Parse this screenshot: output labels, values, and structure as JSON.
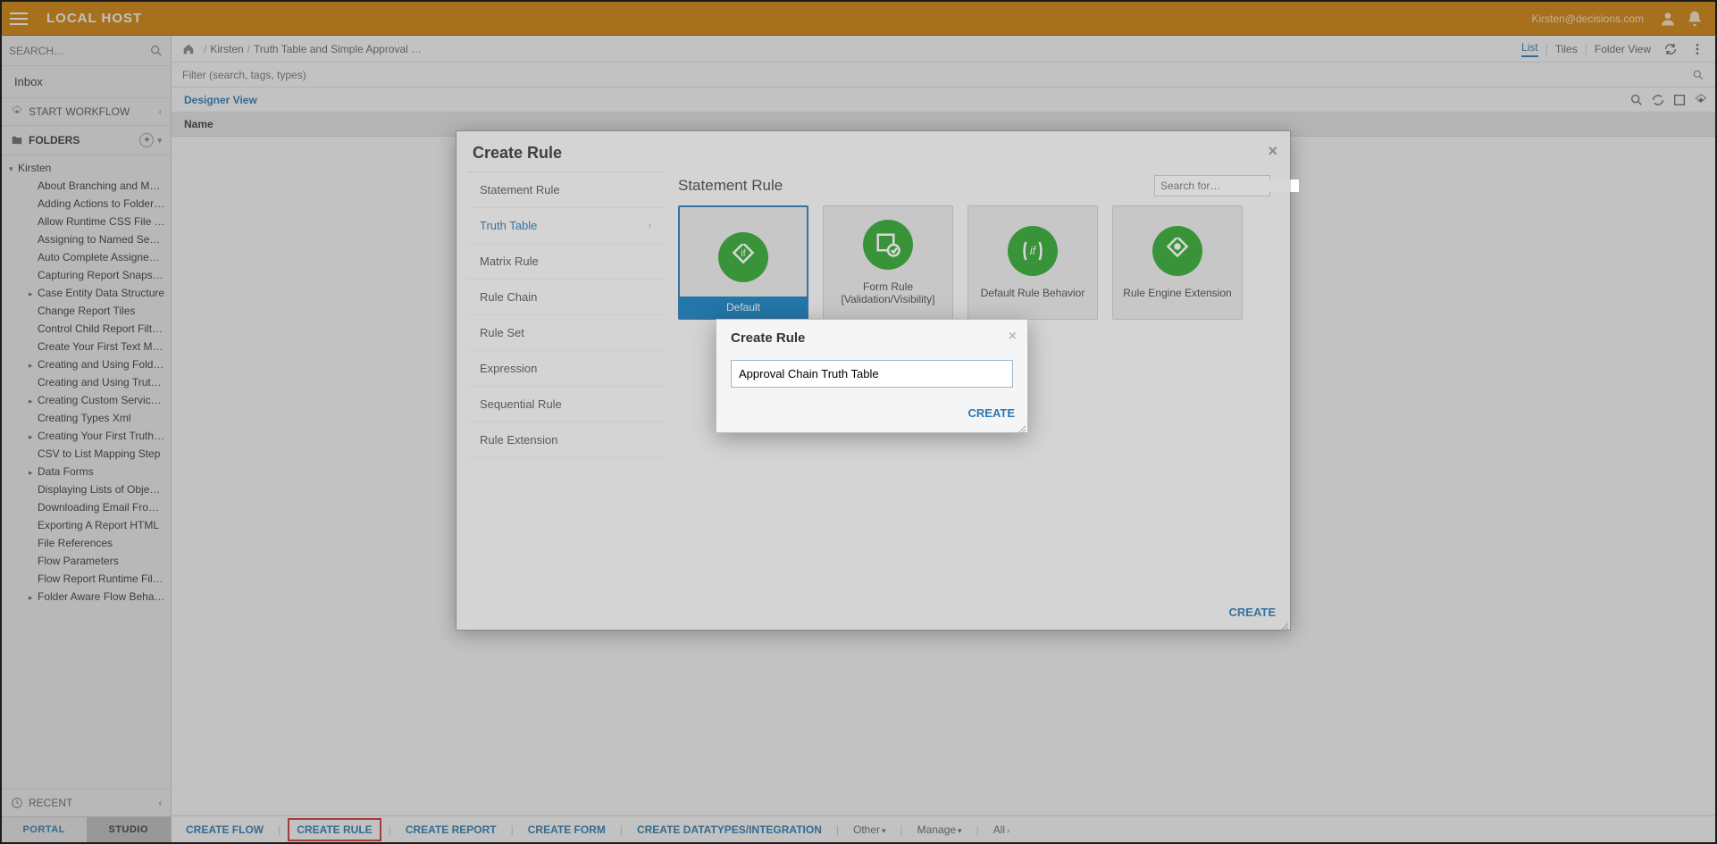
{
  "topbar": {
    "title": "LOCAL HOST",
    "user": "Kirsten@decisions.com"
  },
  "sidebar": {
    "search_placeholder": "SEARCH…",
    "inbox": "Inbox",
    "start_workflow": "START WORKFLOW",
    "folders_label": "FOLDERS",
    "root": "Kirsten",
    "items": [
      {
        "label": "About Branching and Merging Fl",
        "expand": false
      },
      {
        "label": "Adding Actions to Folder Extens",
        "expand": false
      },
      {
        "label": "Allow Runtime CSS File Name",
        "expand": false
      },
      {
        "label": "Assigning to Named Sessions",
        "expand": false
      },
      {
        "label": "Auto Complete Assigned Form",
        "expand": false
      },
      {
        "label": "Capturing Report Snapshot",
        "expand": false
      },
      {
        "label": "Case Entity Data Structure",
        "expand": true
      },
      {
        "label": "Change Report Tiles",
        "expand": false
      },
      {
        "label": "Control Child Report Filter Value",
        "expand": false
      },
      {
        "label": "Create Your First Text Merge",
        "expand": false
      },
      {
        "label": "Creating and Using Folder Exten",
        "expand": true
      },
      {
        "label": "Creating and Using Truth Tables",
        "expand": false
      },
      {
        "label": "Creating Custom Service Catalo",
        "expand": true
      },
      {
        "label": "Creating Types Xml",
        "expand": false
      },
      {
        "label": "Creating Your First Truth Table",
        "expand": true
      },
      {
        "label": "CSV to List Mapping Step",
        "expand": false
      },
      {
        "label": "Data Forms",
        "expand": true
      },
      {
        "label": "Displaying Lists of Objects In A",
        "expand": false
      },
      {
        "label": "Downloading Email From a Mail",
        "expand": false
      },
      {
        "label": "Exporting A Report HTML",
        "expand": false
      },
      {
        "label": "File References",
        "expand": false
      },
      {
        "label": "Flow Parameters",
        "expand": false
      },
      {
        "label": "Flow Report Runtime Filters",
        "expand": false
      },
      {
        "label": "Folder Aware Flow Behavior",
        "expand": true
      }
    ],
    "recent": "RECENT",
    "tab_portal": "PORTAL",
    "tab_studio": "STUDIO"
  },
  "breadcrumb": {
    "seg1": "Kirsten",
    "seg2": "Truth Table and Simple Approval …",
    "view_list": "List",
    "view_tiles": "Tiles",
    "view_folder": "Folder View"
  },
  "filter_placeholder": "Filter (search, tags, types)",
  "designer_view": "Designer View",
  "table": {
    "name_col": "Name"
  },
  "bottom_actions": {
    "create_flow": "CREATE FLOW",
    "create_rule": "CREATE RULE",
    "create_report": "CREATE REPORT",
    "create_form": "CREATE FORM",
    "create_datatypes": "CREATE DATATYPES/INTEGRATION",
    "other": "Other",
    "manage": "Manage",
    "all": "All"
  },
  "modal1": {
    "title": "Create Rule",
    "categories": [
      "Statement Rule",
      "Truth Table",
      "Matrix Rule",
      "Rule Chain",
      "Rule Set",
      "Expression",
      "Sequential Rule",
      "Rule Extension"
    ],
    "active_category_index": 1,
    "template_header": "Statement Rule",
    "search_placeholder": "Search for…",
    "templates": [
      {
        "label": "Default",
        "selected": true
      },
      {
        "label": "Form Rule [Validation/Visibility]",
        "selected": false
      },
      {
        "label": "Default Rule Behavior",
        "selected": false
      },
      {
        "label": "Rule Engine Extension",
        "selected": false
      }
    ],
    "create_btn": "CREATE"
  },
  "modal2": {
    "title": "Create Rule",
    "input_value": "Approval Chain Truth Table",
    "create_btn": "CREATE"
  }
}
